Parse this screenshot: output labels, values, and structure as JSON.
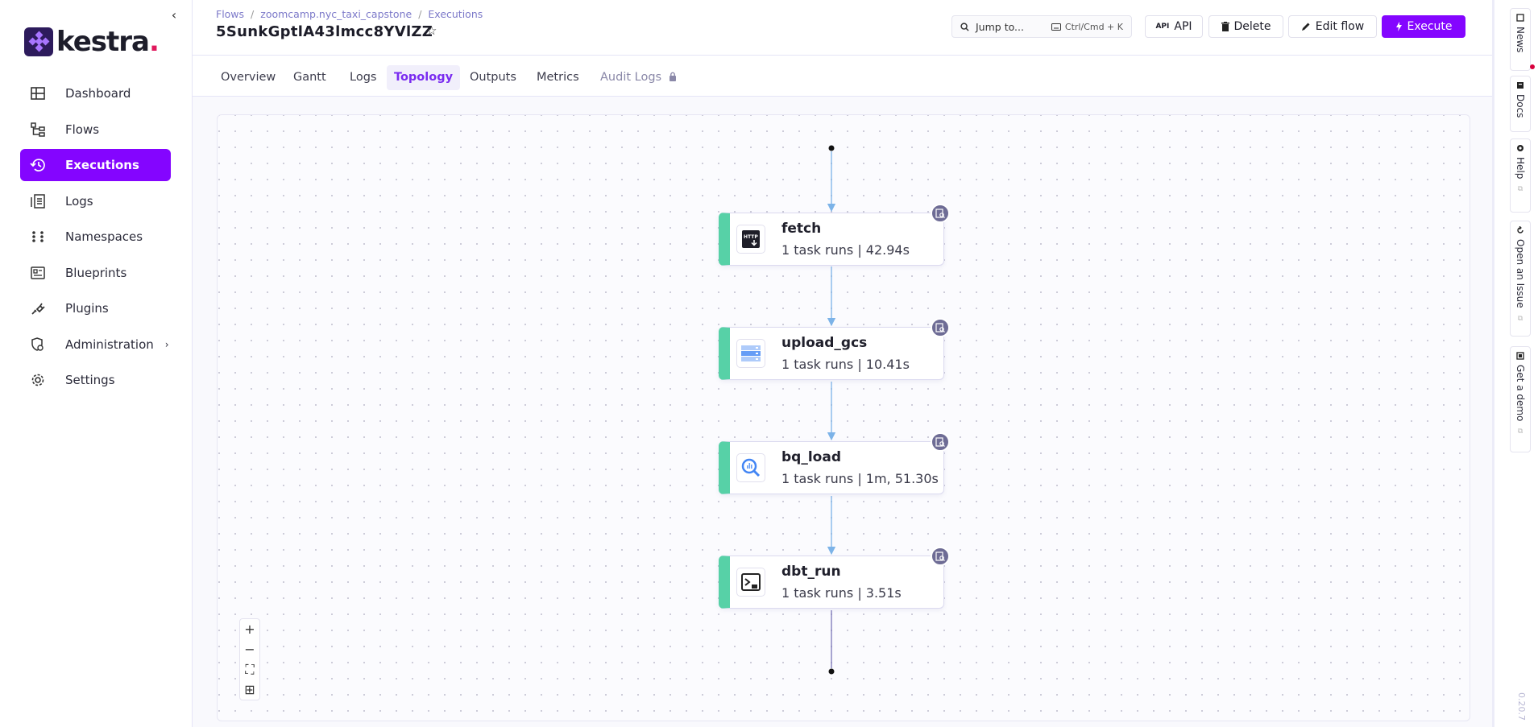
{
  "brand": {
    "logo_text": "kestra",
    "logo_dot": "."
  },
  "sidebar": {
    "collapse_icon": "chevron-left-icon",
    "items": [
      {
        "label": "Dashboard",
        "icon": "dashboard-icon"
      },
      {
        "label": "Flows",
        "icon": "flows-icon"
      },
      {
        "label": "Executions",
        "icon": "history-icon",
        "active": true
      },
      {
        "label": "Logs",
        "icon": "logs-icon"
      },
      {
        "label": "Namespaces",
        "icon": "namespaces-icon"
      },
      {
        "label": "Blueprints",
        "icon": "blueprints-icon"
      },
      {
        "label": "Plugins",
        "icon": "plugins-icon"
      },
      {
        "label": "Administration",
        "icon": "administration-icon",
        "has_children": true
      },
      {
        "label": "Settings",
        "icon": "gear-icon"
      }
    ]
  },
  "header": {
    "breadcrumb": [
      "Flows",
      "zoomcamp.nyc_taxi_capstone",
      "Executions"
    ],
    "title": "5SunkGptlA43lmcc8YVlZZ",
    "search": {
      "placeholder": "Jump to...",
      "shortcut": "Ctrl/Cmd + K"
    },
    "buttons": {
      "api": "API",
      "delete": "Delete",
      "edit": "Edit flow",
      "execute": "Execute"
    }
  },
  "tabs": [
    {
      "label": "Overview"
    },
    {
      "label": "Gantt"
    },
    {
      "label": "Logs"
    },
    {
      "label": "Topology",
      "active": true
    },
    {
      "label": "Outputs"
    },
    {
      "label": "Metrics"
    },
    {
      "label": "Audit Logs",
      "locked": true
    }
  ],
  "topology": {
    "nodes": [
      {
        "name": "fetch",
        "meta": "1 task runs | 42.94s",
        "icon": "http-download-icon"
      },
      {
        "name": "upload_gcs",
        "meta": "1 task runs | 10.41s",
        "icon": "gcs-bucket-icon"
      },
      {
        "name": "bq_load",
        "meta": "1 task runs | 1m, 51.30s",
        "icon": "bigquery-icon"
      },
      {
        "name": "dbt_run",
        "meta": "1 task runs | 3.51s",
        "icon": "terminal-icon"
      }
    ],
    "status_color": "#57d1a7"
  },
  "zoom_controls": [
    "+",
    "−",
    "⛶",
    "⊞"
  ],
  "right_rail": {
    "items": [
      "News",
      "Docs",
      "Help",
      "Open an Issue",
      "Get a demo"
    ],
    "version": "0.20.7"
  },
  "colors": {
    "accent": "#8405ff",
    "success": "#57d1a7",
    "edge": "#7cb3e8"
  }
}
